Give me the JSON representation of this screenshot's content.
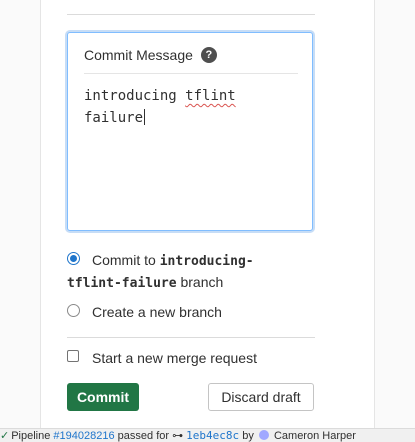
{
  "commit_panel": {
    "header_label": "Commit Message",
    "help_icon": "?",
    "message_line1_word1": "introducing",
    "message_line1_word2": "tflint",
    "message_line2": "failure"
  },
  "options": {
    "commit_to_prefix": "Commit to",
    "branch_name_part1": "introducing-",
    "branch_name_part2": "tflint-failure",
    "branch_suffix": "branch",
    "create_new_branch": "Create a new branch",
    "start_merge_request": "Start a new merge request"
  },
  "buttons": {
    "commit": "Commit",
    "discard": "Discard draft"
  },
  "status": {
    "pipeline_label": "Pipeline",
    "pipeline_id": "#194028216",
    "passed_for": "passed for",
    "commit_sha": "1eb4ec8c",
    "by": "by",
    "author": "Cameron Harper"
  },
  "colors": {
    "commit_button": "#217645",
    "focus_border": "#80bdff",
    "radio_selected": "#1f75cb"
  }
}
